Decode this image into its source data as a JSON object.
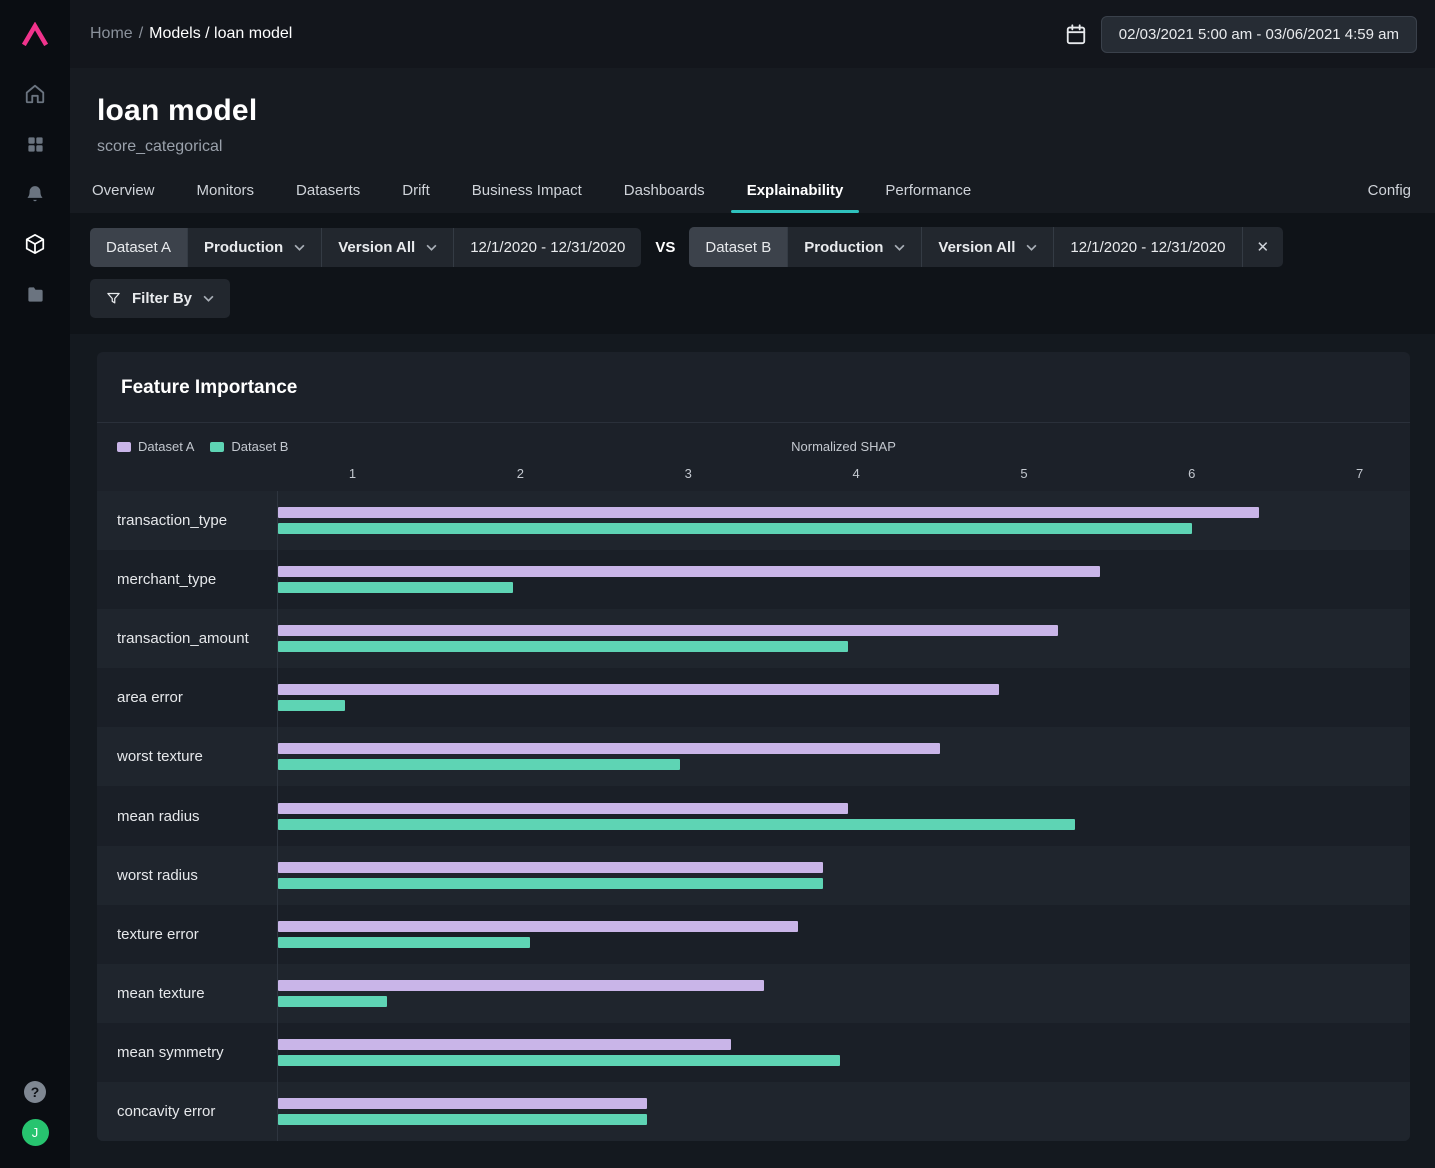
{
  "colors": {
    "brand": "#f1338c",
    "accent": "#2fc1bd",
    "avatar": "#27c46f",
    "dataset_a": "#c9b5e8",
    "dataset_b": "#5ed4b4"
  },
  "sidebar": {
    "items": [
      {
        "name": "home",
        "active": false
      },
      {
        "name": "dashboards-grid",
        "active": false
      },
      {
        "name": "notifications-bell",
        "active": false
      },
      {
        "name": "models-cube",
        "active": true
      },
      {
        "name": "projects-folder",
        "active": false
      }
    ],
    "help_label": "?",
    "avatar_initial": "J"
  },
  "topbar": {
    "breadcrumb_home": "Home",
    "breadcrumb_sep": "/",
    "breadcrumb_rest": "Models / loan model",
    "date_range": "02/03/2021 5:00 am - 03/06/2021 4:59 am"
  },
  "header": {
    "title": "loan model",
    "subtitle": "score_categorical",
    "tabs": [
      "Overview",
      "Monitors",
      "Dataserts",
      "Drift",
      "Business Impact",
      "Dashboards",
      "Explainability",
      "Performance"
    ],
    "active_tab": "Explainability",
    "config_label": "Config"
  },
  "filters": {
    "vs_label": "VS",
    "filter_by_label": "Filter By",
    "close_label": "✕",
    "groups": [
      {
        "dataset": "Dataset A",
        "environment": "Production",
        "version": "Version All",
        "date_range": "12/1/2020 - 12/31/2020",
        "closable": false
      },
      {
        "dataset": "Dataset B",
        "environment": "Production",
        "version": "Version All",
        "date_range": "12/1/2020 - 12/31/2020",
        "closable": true
      }
    ]
  },
  "chart_data": {
    "type": "bar",
    "orientation": "horizontal",
    "title": "Feature Importance",
    "axis_label": "Normalized SHAP",
    "xlabel": "Normalized SHAP",
    "axis_min": 0.55,
    "axis_max": 7.3,
    "ticks": [
      1,
      2,
      3,
      4,
      5,
      6,
      7
    ],
    "grid": false,
    "legend_position": "top-left",
    "categories": [
      "transaction_type",
      "merchant_type",
      "transaction_amount",
      "area error",
      "worst texture",
      "mean radius",
      "worst radius",
      "texture error",
      "mean texture",
      "mean symmetry",
      "concavity error"
    ],
    "series": [
      {
        "name": "Dataset A",
        "color": "#c9b5e8",
        "values": [
          6.4,
          5.45,
          5.2,
          4.85,
          4.5,
          3.95,
          3.8,
          3.65,
          3.45,
          3.25,
          2.75
        ]
      },
      {
        "name": "Dataset B",
        "color": "#5ed4b4",
        "values": [
          6.0,
          1.95,
          3.95,
          0.95,
          2.95,
          5.3,
          3.8,
          2.05,
          1.2,
          3.9,
          2.75
        ]
      }
    ]
  }
}
